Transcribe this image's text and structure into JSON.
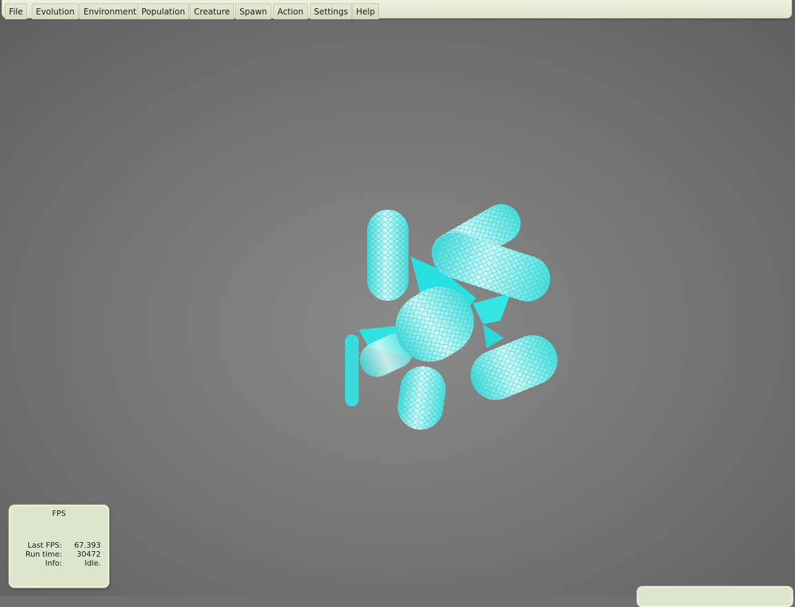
{
  "menu": {
    "items": [
      {
        "id": "file",
        "label": "File"
      },
      {
        "id": "evolution",
        "label": "Evolution"
      },
      {
        "id": "environment",
        "label": "Environment"
      },
      {
        "id": "population",
        "label": "Population"
      },
      {
        "id": "creature",
        "label": "Creature"
      },
      {
        "id": "spawn",
        "label": "Spawn"
      },
      {
        "id": "action",
        "label": "Action"
      },
      {
        "id": "settings",
        "label": "Settings"
      },
      {
        "id": "help",
        "label": "Help"
      }
    ]
  },
  "fps_panel": {
    "title": "FPS",
    "rows": [
      {
        "label": "Last FPS:",
        "value": "67.393"
      },
      {
        "label": "Run time:",
        "value": "30472"
      },
      {
        "label": "Info:",
        "value": "Idle."
      }
    ]
  },
  "scene": {
    "floor_pattern": "hexagon-tiles",
    "floor_color": "#7a7a7a",
    "floor_edge_color": "#5a5a5a",
    "creature_color": "#3ee8e8",
    "creature_highlight": "#c8fbfb"
  }
}
